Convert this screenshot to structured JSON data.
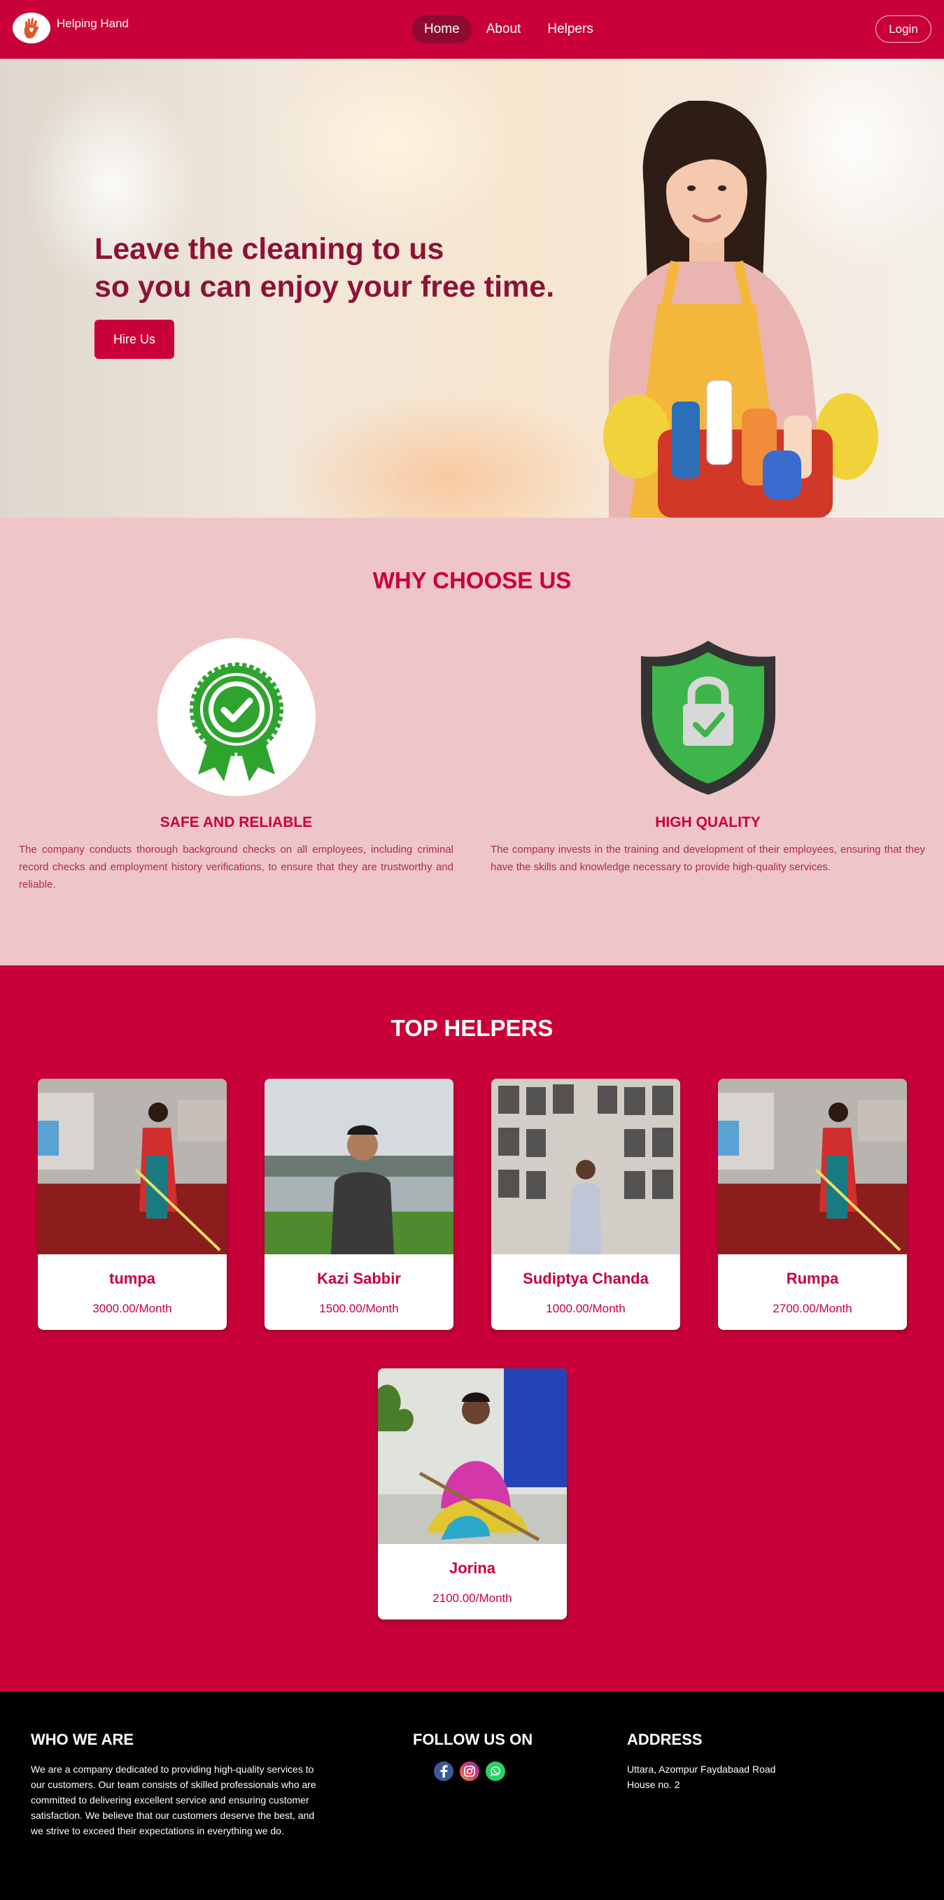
{
  "brand": {
    "name": "Helping Hand"
  },
  "nav": {
    "links": [
      {
        "label": "Home",
        "active": true
      },
      {
        "label": "About",
        "active": false
      },
      {
        "label": "Helpers",
        "active": false
      }
    ],
    "login_label": "Login"
  },
  "hero": {
    "title_line1": "Leave the cleaning to us",
    "title_line2": "so you can enjoy your free time.",
    "cta_label": "Hire Us"
  },
  "why": {
    "title": "WHY CHOOSE US",
    "features": [
      {
        "icon": "award-badge-icon",
        "title": "SAFE AND RELIABLE",
        "description": "The company conducts thorough background checks on all employees, including criminal record checks and employment history verifications, to ensure that they are trustworthy and reliable."
      },
      {
        "icon": "shield-lock-icon",
        "title": "HIGH QUALITY",
        "description": "The company invests in the training and development of their employees, ensuring that they have the skills and knowledge necessary to provide high-quality services."
      }
    ]
  },
  "helpers": {
    "title": "TOP HELPERS",
    "items": [
      {
        "name": "tumpa",
        "salary": "3000.00/Month"
      },
      {
        "name": "Kazi Sabbir",
        "salary": "1500.00/Month"
      },
      {
        "name": "Sudiptya Chanda",
        "salary": "1000.00/Month"
      },
      {
        "name": "Rumpa",
        "salary": "2700.00/Month"
      },
      {
        "name": "Jorina",
        "salary": "2100.00/Month"
      }
    ]
  },
  "footer": {
    "who_title": "WHO WE ARE",
    "who_text": "We are a company dedicated to providing high-quality services to our customers. Our team consists of skilled professionals who are committed to delivering excellent service and ensuring customer satisfaction. We believe that our customers deserve the best, and we strive to exceed their expectations in everything we do.",
    "follow_title": "FOLLOW US ON",
    "socials": [
      "facebook-icon",
      "instagram-icon",
      "whatsapp-icon"
    ],
    "address_title": "ADDRESS",
    "address_line1": "Uttara, Azompur Faydabaad Road",
    "address_line2": "House no. 2"
  },
  "colors": {
    "primary": "#c9003a",
    "dark_accent": "#8c1238",
    "pink_bg": "#eec6c8",
    "footer_bg": "#000000"
  }
}
